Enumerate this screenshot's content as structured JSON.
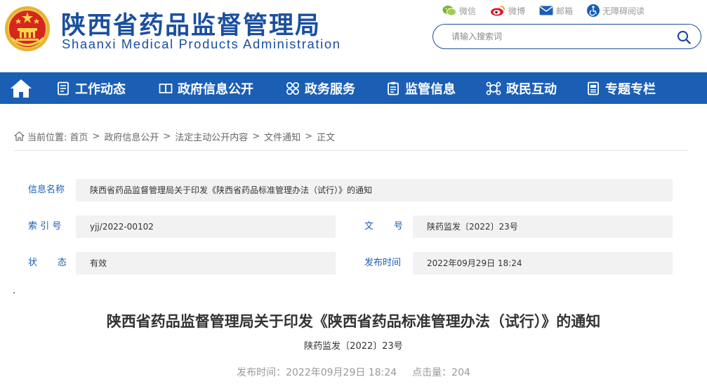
{
  "header": {
    "title_cn": "陕西省药品监督管理局",
    "title_en": "Shaanxi Medical Products Administration",
    "emblem_icon": "national-emblem-icon",
    "brand_color": "#1a4fa0"
  },
  "top_links": [
    {
      "label": "微信",
      "icon": "wechat-icon",
      "color": "#7bb32e"
    },
    {
      "label": "微博",
      "icon": "weibo-icon",
      "color": "#e6162d"
    },
    {
      "label": "邮箱",
      "icon": "mail-icon",
      "color": "#1a5fb4"
    },
    {
      "label": "无障碍阅读",
      "icon": "accessibility-icon",
      "color": "#1a5fb4"
    }
  ],
  "search": {
    "placeholder": "请输入搜索词",
    "icon": "search-icon"
  },
  "nav": {
    "bg_color": "#1a5fb4",
    "home_icon": "home-icon",
    "items": [
      {
        "label": "工作动态",
        "icon": "list-icon"
      },
      {
        "label": "政府信息公开",
        "icon": "book-icon"
      },
      {
        "label": "政务服务",
        "icon": "grid-icon"
      },
      {
        "label": "监管信息",
        "icon": "clipboard-icon"
      },
      {
        "label": "政民互动",
        "icon": "interaction-icon"
      },
      {
        "label": "专题专栏",
        "icon": "folder-icon"
      }
    ]
  },
  "breadcrumb": {
    "prefix": "当前位置:",
    "separator": ">",
    "items": [
      "首页",
      "政府信息公开",
      "法定主动公开内容",
      "文件通知",
      "正文"
    ]
  },
  "info": {
    "name_label": "信息名称",
    "name_value": "陕西省药品监督管理局关于印发《陕西省药品标准管理办法（试行）》的通知",
    "index_label": "索 引 号",
    "index_value": "yjj/2022-00102",
    "docno_label": "文       号",
    "docno_value": "陕药监发〔2022〕23号",
    "status_label": "状       态",
    "status_value": "有效",
    "date_label": "发布时间",
    "date_value": "2022年09月29日 18:24"
  },
  "stray_mark": ".",
  "article": {
    "title": "陕西省药品监督管理局关于印发《陕西省药品标准管理办法（试行）》的通知",
    "doc_number": "陕药监发〔2022〕23号",
    "publish_label": "发布时间：",
    "publish_time": "2022年09月29日 18:24",
    "clicks_label": "点击量：",
    "clicks": "204"
  }
}
